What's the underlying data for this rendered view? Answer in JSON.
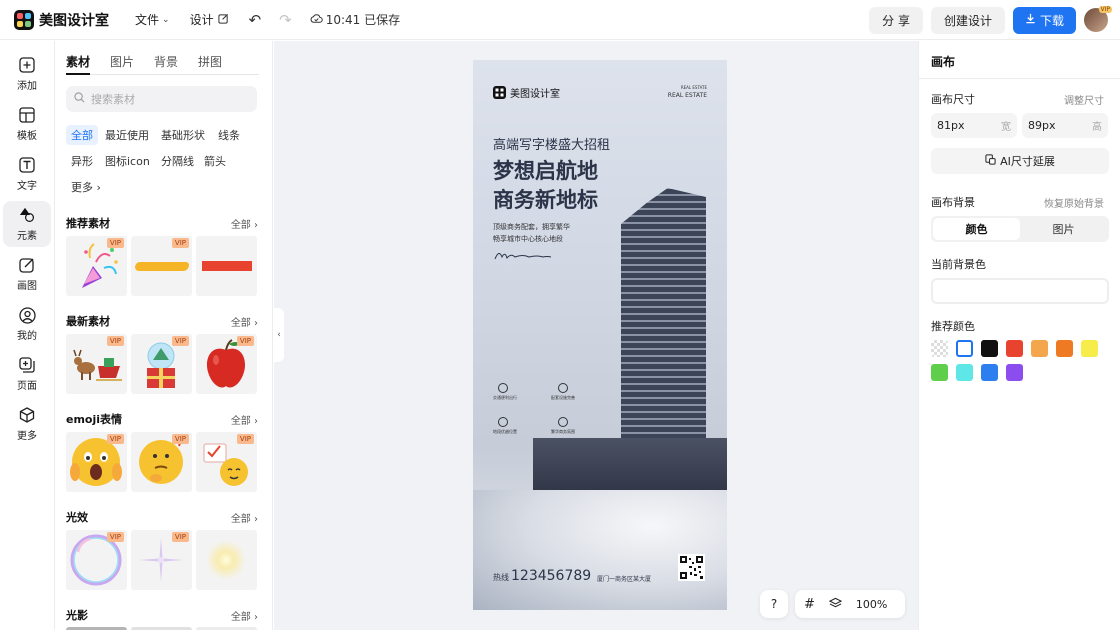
{
  "app": {
    "name": "美图设计室"
  },
  "menu": {
    "file": "文件",
    "design": "设计",
    "saved": "10:41 已保存"
  },
  "top_actions": {
    "share": "分 享",
    "create": "创建设计",
    "download": "下载",
    "avatar_badge": "VIP"
  },
  "rail": [
    {
      "label": "添加",
      "icon": "plus-square-icon"
    },
    {
      "label": "模板",
      "icon": "template-icon"
    },
    {
      "label": "文字",
      "icon": "text-icon"
    },
    {
      "label": "元素",
      "icon": "shapes-icon",
      "active": true
    },
    {
      "label": "画图",
      "icon": "edit-icon"
    },
    {
      "label": "我的",
      "icon": "user-icon"
    },
    {
      "label": "页面",
      "icon": "add-page-icon"
    },
    {
      "label": "更多",
      "icon": "cube-icon"
    }
  ],
  "panel": {
    "tabs": [
      "素材",
      "图片",
      "背景",
      "拼图"
    ],
    "search_placeholder": "搜索素材",
    "chips": [
      "全部",
      "最近使用",
      "基础形状",
      "线条",
      "异形",
      "图标icon",
      "分隔线",
      "箭头",
      "更多"
    ],
    "more_label": "全部",
    "vip": "VIP",
    "sections": [
      {
        "title": "推荐素材"
      },
      {
        "title": "最新素材"
      },
      {
        "title": "emoji表情"
      },
      {
        "title": "光效"
      },
      {
        "title": "光影"
      }
    ]
  },
  "poster": {
    "brand": "美图设计室",
    "brand_right_top": "REAL ESTATE",
    "brand_right": "REAL ESTATE",
    "subtitle": "高端写字楼盛大招租",
    "headline1": "梦想启航地",
    "headline2": "商务新地标",
    "desc1": "顶级商务配套，拥享繁华",
    "desc2": "畅享城市中心核心地段",
    "phone": "123456789",
    "phone_prefix": "热线",
    "address": "厦门一商务区某大厦",
    "features": [
      "交通便利出行",
      "配套设施完善",
      "地段优越位置",
      "繁华商务氛围"
    ]
  },
  "zoom": {
    "help": "?",
    "value": "100%"
  },
  "right": {
    "title": "画布",
    "size_label": "画布尺寸",
    "size_link": "调整尺寸",
    "width_value": "81px",
    "width_unit": "宽",
    "height_value": "89px",
    "height_unit": "高",
    "ai_button": "AI尺寸延展",
    "bg_label": "画布背景",
    "bg_link": "恢复原始背景",
    "seg_color": "颜色",
    "seg_image": "图片",
    "current_label": "当前背景色",
    "recommend_label": "推荐颜色",
    "swatches": [
      "transparent",
      "#ffffff",
      "#111111",
      "#e8432e",
      "#f4a64c",
      "#ef7a24",
      "#f7ed4a",
      "#5fcf4b",
      "#5fe6e6",
      "#2d7ff0",
      "#8b4ded"
    ]
  }
}
